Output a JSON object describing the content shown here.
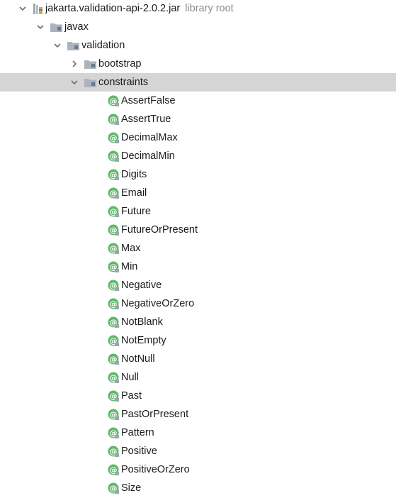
{
  "tree": {
    "root": {
      "label": "jakarta.validation-api-2.0.2.jar",
      "hint": "library root",
      "icon": "jar-library-icon"
    },
    "javax": {
      "label": "javax",
      "icon": "package-folder-icon"
    },
    "validation": {
      "label": "validation",
      "icon": "package-folder-icon"
    },
    "bootstrap": {
      "label": "bootstrap",
      "icon": "package-folder-icon",
      "expanded": false
    },
    "constraints": {
      "label": "constraints",
      "icon": "package-folder-icon",
      "expanded": true,
      "selected": true
    },
    "annotations": [
      "AssertFalse",
      "AssertTrue",
      "DecimalMax",
      "DecimalMin",
      "Digits",
      "Email",
      "Future",
      "FutureOrPresent",
      "Max",
      "Min",
      "Negative",
      "NegativeOrZero",
      "NotBlank",
      "NotEmpty",
      "NotNull",
      "Null",
      "Past",
      "PastOrPresent",
      "Pattern",
      "Positive",
      "PositiveOrZero",
      "Size"
    ],
    "annotation_icon": "annotation-type-icon"
  },
  "colors": {
    "selection": "#d5d5d5",
    "annotation_icon": "#5fb86a",
    "package_icon": "#9aa6b2",
    "hint_text": "#8c8c8c"
  }
}
